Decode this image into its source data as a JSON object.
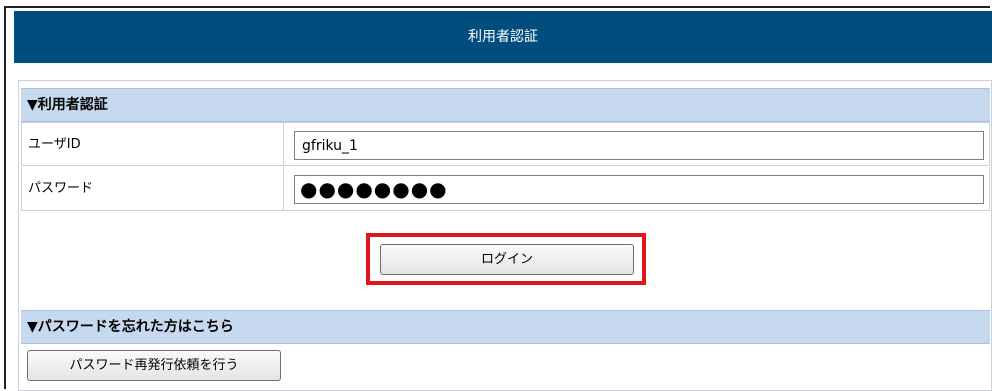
{
  "titlebar": {
    "title": "利用者認証"
  },
  "auth_section": {
    "header": "▼利用者認証"
  },
  "form": {
    "user_id": {
      "label": "ユーザID",
      "value": "gfriku_1"
    },
    "password": {
      "label": "パスワード",
      "value": "●●●●●●●●"
    }
  },
  "login_button": {
    "label": "ログイン"
  },
  "forgot_section": {
    "header": "▼パスワードを忘れた方はこちら"
  },
  "reissue_button": {
    "label": "パスワード再発行依頼を行う"
  },
  "colors": {
    "titlebar_bg": "#004d7e",
    "section_bg": "#c7d9ef",
    "highlight_border": "#e0161c"
  }
}
